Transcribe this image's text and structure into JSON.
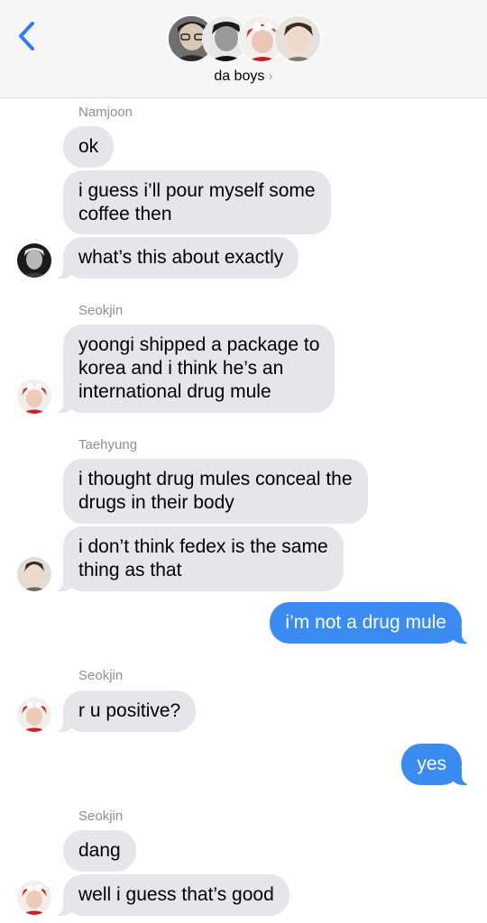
{
  "header": {
    "title": "da boys",
    "chevron": "›"
  },
  "colors": {
    "accent": "#3b8cf2",
    "incoming_bubble": "#e5e5ea",
    "sender_text": "#8e8e93"
  },
  "messages": [
    {
      "sender": "Namjoon",
      "lines": [
        "ok"
      ]
    },
    {
      "lines": [
        "i guess i’ll pour myself some",
        "coffee then"
      ]
    },
    {
      "lines": [
        "what’s this about exactly"
      ]
    },
    {
      "sender": "Seokjin",
      "lines": [
        "yoongi shipped a package to",
        "korea and i think he’s an",
        "international drug mule"
      ]
    },
    {
      "sender": "Taehyung",
      "lines": [
        "i thought drug mules conceal the",
        "drugs in their body"
      ]
    },
    {
      "lines": [
        "i don’t think fedex is the same",
        "thing as that"
      ]
    },
    {
      "lines": [
        "i’m not a drug mule"
      ]
    },
    {
      "sender": "Seokjin",
      "lines": [
        "r u positive?"
      ]
    },
    {
      "lines": [
        "yes"
      ]
    },
    {
      "sender": "Seokjin",
      "lines": [
        "dang"
      ]
    },
    {
      "lines": [
        "well i guess that’s good"
      ]
    }
  ]
}
